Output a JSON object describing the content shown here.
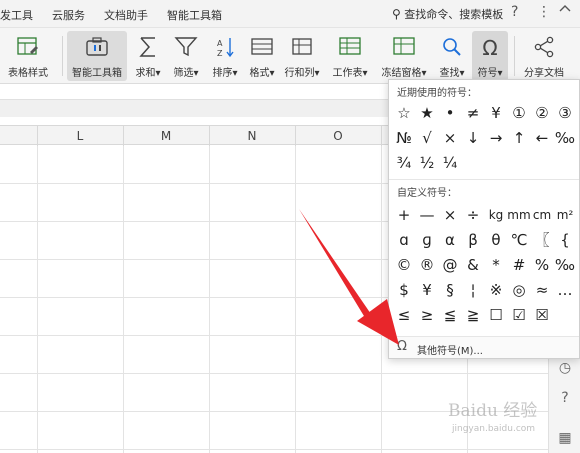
{
  "menubar": {
    "items": [
      "发工具",
      "云服务",
      "文档助手",
      "智能工具箱"
    ],
    "search_text": "查找命令、搜索模板",
    "help": "?",
    "more": "⋮",
    "collapse": "^"
  },
  "toolbar": {
    "items": [
      {
        "label": "表格样式",
        "icon": "table-style-icon"
      },
      {
        "label": "智能工具箱",
        "icon": "smart-toolbox-icon"
      },
      {
        "label": "求和",
        "icon": "sum-icon"
      },
      {
        "label": "筛选",
        "icon": "filter-icon"
      },
      {
        "label": "排序",
        "icon": "sort-icon"
      },
      {
        "label": "格式",
        "icon": "format-icon"
      },
      {
        "label": "行和列",
        "icon": "rows-cols-icon"
      },
      {
        "label": "工作表",
        "icon": "worksheet-icon"
      },
      {
        "label": "冻结窗格",
        "icon": "freeze-panes-icon"
      },
      {
        "label": "查找",
        "icon": "find-icon"
      },
      {
        "label": "符号",
        "icon": "symbol-icon"
      },
      {
        "label": "分享文档",
        "icon": "share-icon"
      }
    ]
  },
  "columns": [
    "L",
    "M",
    "N",
    "O"
  ],
  "dropdown": {
    "recent_title": "近期使用的符号：",
    "recent_row1": [
      "☆",
      "★",
      "•",
      "≠",
      "¥",
      "①",
      "②",
      "③"
    ],
    "recent_row2": [
      "№",
      "√",
      "×",
      "↓",
      "→",
      "↑",
      "←",
      "‰"
    ],
    "recent_row3": [
      "¾",
      "½",
      "¼"
    ],
    "custom_title": "自定义符号：",
    "custom_rows": [
      [
        "+",
        "—",
        "×",
        "÷",
        "kg",
        "mm",
        "cm",
        "m²"
      ],
      [
        "ɑ",
        "ɡ",
        "α",
        "β",
        "θ",
        "℃",
        "〖",
        "{"
      ],
      [
        "©",
        "®",
        "@",
        "&",
        "*",
        "#",
        "%",
        "‰"
      ],
      [
        "$",
        "¥",
        "§",
        "¦",
        "※",
        "◎",
        "≈",
        "…"
      ],
      [
        "≤",
        "≥",
        "≦",
        "≧",
        "☐",
        "☑",
        "☒",
        ""
      ]
    ],
    "more_label": "其他符号(M)..."
  },
  "watermark": {
    "text": "Baidu 经验",
    "url": "jingyan.baidu.com"
  },
  "colors": {
    "arrow": "#e8262b",
    "menubar_bg": "#f3f3f3",
    "toolbar_bg": "#f5f5f5"
  }
}
